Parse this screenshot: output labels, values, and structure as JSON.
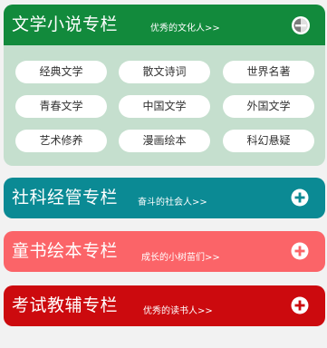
{
  "sections": [
    {
      "title": "文学小说专栏",
      "subtitle": "优秀的文化人>>",
      "expanded": true,
      "color": "#128a3c",
      "body_color": "#c5dfce",
      "toggle_icon": "collapse-icon",
      "tags": [
        "经典文学",
        "散文诗词",
        "世界名著",
        "青春文学",
        "中国文学",
        "外国文学",
        "艺术修养",
        "漫画绘本",
        "科幻悬疑"
      ]
    },
    {
      "title": "社科经管专栏",
      "subtitle": "奋斗的社会人>>",
      "expanded": false,
      "color": "#0b8a94",
      "toggle_icon": "plus-circle-icon"
    },
    {
      "title": "童书绘本专栏",
      "subtitle": "成长的小树苗们>>",
      "expanded": false,
      "color": "#fb6468",
      "toggle_icon": "plus-circle-icon"
    },
    {
      "title": "考试教辅专栏",
      "subtitle": "优秀的读书人>>",
      "expanded": false,
      "color": "#cc0a0e",
      "toggle_icon": "plus-circle-icon"
    }
  ]
}
